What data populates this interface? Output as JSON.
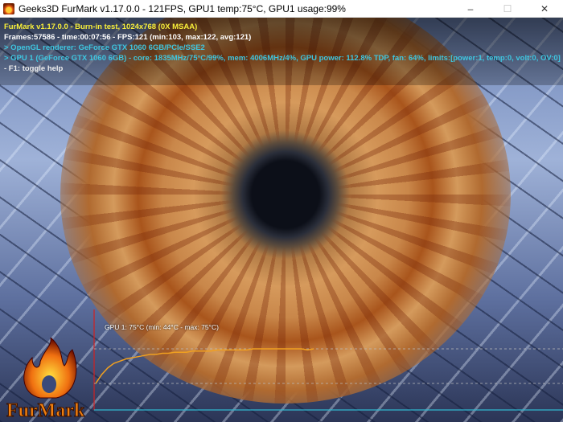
{
  "window": {
    "title": "Geeks3D FurMark v1.17.0.0 - 121FPS, GPU1 temp:75°C, GPU1 usage:99%",
    "minimize": "–",
    "maximize": "☐",
    "close": "✕"
  },
  "hud": {
    "line1": "FurMark v1.17.0.0 - Burn-in test, 1024x768 (0X MSAA)",
    "line2": "Frames:57586 - time:00:07:56 - FPS:121 (min:103, max:122, avg:121)",
    "line3": "> OpenGL renderer: GeForce GTX 1060 6GB/PCIe/SSE2",
    "line4": "> GPU 1 (GeForce GTX 1060 6GB) - core: 1835MHz/75°C/99%, mem: 4006MHz/4%, GPU power: 112.8% TDP, fan: 64%, limits:[power:1, temp:0, volt:0, OV:0]",
    "line5": "- F1: toggle help"
  },
  "graph": {
    "label": "GPU 1: 75°C (min: 44°C - max: 75°C)",
    "current_c": 75,
    "min_c": 44,
    "max_c": 75,
    "temps": [
      44,
      52,
      58,
      62,
      64,
      66,
      67,
      68,
      69,
      70,
      70,
      71,
      71,
      72,
      72,
      72,
      73,
      73,
      73,
      73,
      74,
      74,
      74,
      74,
      74,
      74,
      75,
      75,
      75,
      75,
      75,
      75,
      75,
      75,
      75,
      74,
      75
    ],
    "colors": {
      "line": "#f0a020",
      "axis_y": "#d02020",
      "axis_x": "#30b8d0"
    }
  },
  "logo": {
    "text": "FurMark"
  }
}
